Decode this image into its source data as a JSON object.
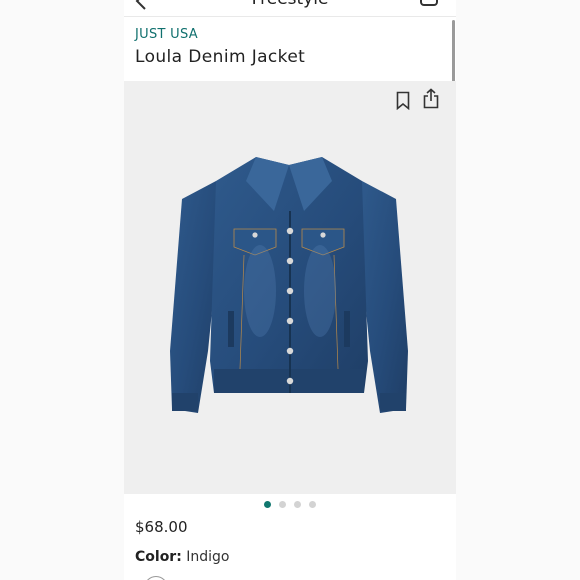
{
  "nav": {
    "title": "Freestyle"
  },
  "product": {
    "brand": "JUST USA",
    "name": "Loula Denim Jacket",
    "price": "$68.00",
    "color_label": "Color:",
    "color_value": "Indigo"
  },
  "gallery": {
    "image_count": 4,
    "active_index": 0
  },
  "colors": {
    "accent": "#10706e",
    "denim": "#274b7a",
    "background": "#efefef"
  },
  "icons": [
    "chevron-left-icon",
    "bag-icon",
    "bookmark-icon",
    "share-icon"
  ]
}
